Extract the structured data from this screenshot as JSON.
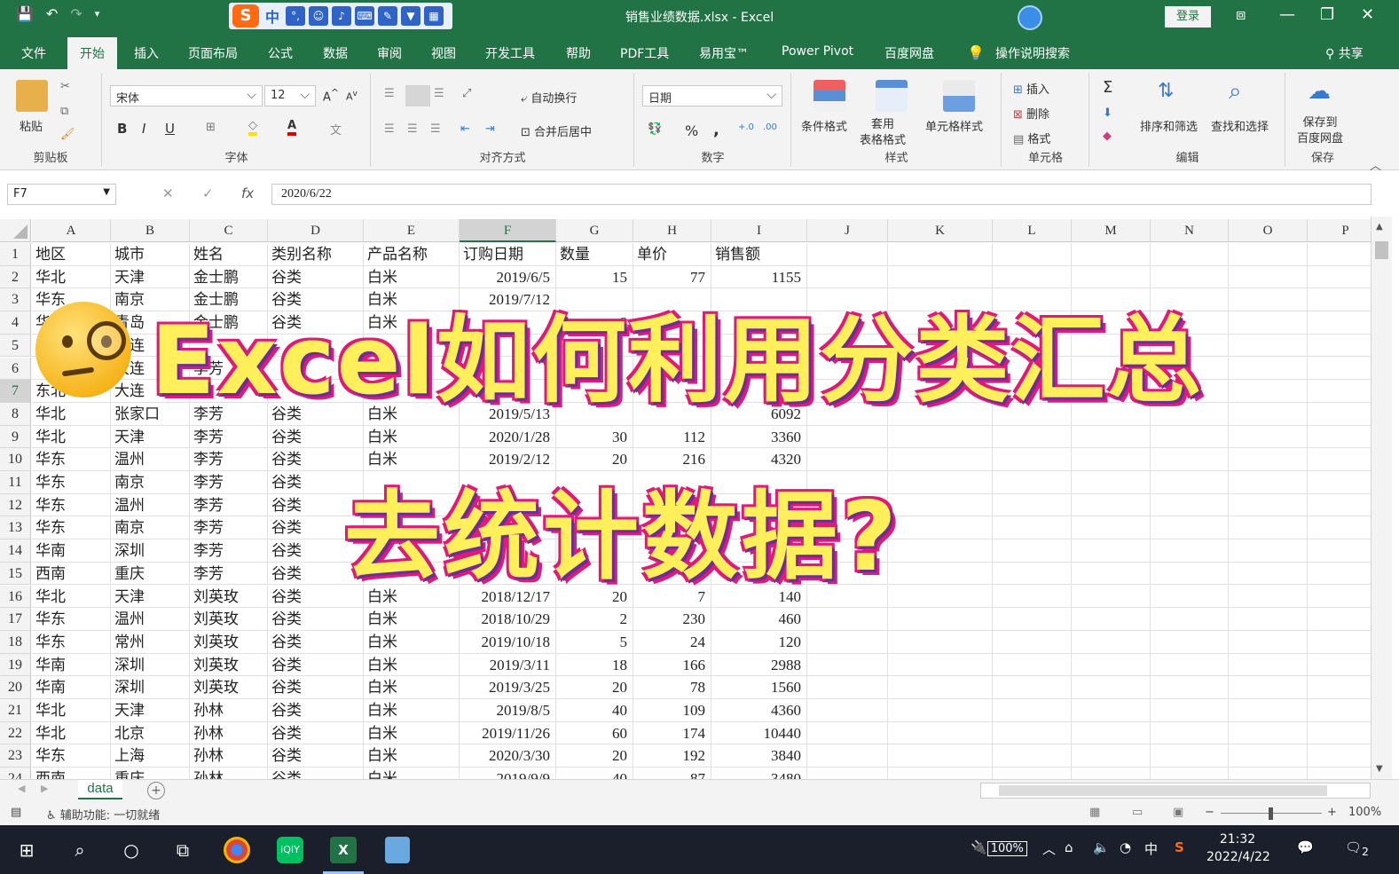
{
  "window": {
    "title": "销售业绩数据.xlsx  -  Excel",
    "login_label": "登录"
  },
  "ime": {
    "logo": "S",
    "mode": "中"
  },
  "tabs": [
    "文件",
    "开始",
    "插入",
    "页面布局",
    "公式",
    "数据",
    "审阅",
    "视图",
    "开发工具",
    "帮助",
    "PDF工具",
    "易用宝™",
    "Power Pivot",
    "百度网盘",
    "操作说明搜索"
  ],
  "active_tab": "开始",
  "share_label": "共享",
  "ribbon": {
    "clipboard": {
      "paste": "粘贴",
      "label": "剪贴板"
    },
    "font": {
      "name": "宋体",
      "size": "12",
      "label": "字体",
      "bold": "B",
      "italic": "I",
      "underline": "U"
    },
    "alignment": {
      "wrap": "自动换行",
      "merge": "合并后居中",
      "label": "对齐方式"
    },
    "number": {
      "format": "日期",
      "label": "数字",
      "percent": "%",
      "comma": ","
    },
    "styles": {
      "conditional": "条件格式",
      "table": "套用\n表格格式",
      "cell_styles": "单元格样式",
      "label": "样式"
    },
    "cells": {
      "insert": "插入",
      "delete": "删除",
      "format": "格式",
      "label": "单元格"
    },
    "editing": {
      "sort": "排序和筛选",
      "find": "查找和选择",
      "label": "编辑",
      "sum": "Σ"
    },
    "save": {
      "button": "保存到\n百度网盘",
      "label": "保存"
    }
  },
  "formula_bar": {
    "cell_ref": "F7",
    "fx": "fx",
    "value": "2020/6/22"
  },
  "columns": [
    "A",
    "B",
    "C",
    "D",
    "E",
    "F",
    "G",
    "H",
    "I",
    "J",
    "K",
    "L",
    "M",
    "N",
    "O",
    "P"
  ],
  "selected_column": "F",
  "selected_row": 7,
  "rows": [
    [
      "地区",
      "城市",
      "姓名",
      "类别名称",
      "产品名称",
      "订购日期",
      "数量",
      "单价",
      "销售额"
    ],
    [
      "华北",
      "天津",
      "金士鹏",
      "谷类",
      "白米",
      "2019/6/5",
      "15",
      "77",
      "1155"
    ],
    [
      "华东",
      "南京",
      "金士鹏",
      "谷类",
      "白米",
      "2019/7/12",
      "",
      "",
      ""
    ],
    [
      "华",
      "青岛",
      "金士鹏",
      "谷类",
      "白米",
      "",
      "8",
      "",
      ""
    ],
    [
      "",
      "大连",
      "",
      "",
      "",
      "",
      "",
      "",
      ""
    ],
    [
      "",
      "大连",
      "李芳",
      "",
      "",
      "",
      "",
      "",
      ""
    ],
    [
      "东北",
      "大连",
      "",
      "",
      "",
      "",
      "",
      "",
      ""
    ],
    [
      "华北",
      "张家口",
      "李芳",
      "谷类",
      "白米",
      "2019/5/13",
      "",
      "",
      "6092"
    ],
    [
      "华北",
      "天津",
      "李芳",
      "谷类",
      "白米",
      "2020/1/28",
      "30",
      "112",
      "3360"
    ],
    [
      "华东",
      "温州",
      "李芳",
      "谷类",
      "白米",
      "2019/2/12",
      "20",
      "216",
      "4320"
    ],
    [
      "华东",
      "南京",
      "李芳",
      "谷类",
      "",
      "",
      "",
      "",
      ""
    ],
    [
      "华东",
      "温州",
      "李芳",
      "谷类",
      "",
      "",
      "",
      "",
      ""
    ],
    [
      "华东",
      "南京",
      "李芳",
      "谷类",
      "",
      "",
      "",
      "",
      ""
    ],
    [
      "华南",
      "深圳",
      "李芳",
      "谷类",
      "",
      "",
      "",
      "",
      ""
    ],
    [
      "西南",
      "重庆",
      "李芳",
      "谷类",
      "",
      "",
      "",
      "",
      ""
    ],
    [
      "华北",
      "天津",
      "刘英玫",
      "谷类",
      "白米",
      "2018/12/17",
      "20",
      "7",
      "140"
    ],
    [
      "华东",
      "温州",
      "刘英玫",
      "谷类",
      "白米",
      "2018/10/29",
      "2",
      "230",
      "460"
    ],
    [
      "华东",
      "常州",
      "刘英玫",
      "谷类",
      "白米",
      "2019/10/18",
      "5",
      "24",
      "120"
    ],
    [
      "华南",
      "深圳",
      "刘英玫",
      "谷类",
      "白米",
      "2019/3/11",
      "18",
      "166",
      "2988"
    ],
    [
      "华南",
      "深圳",
      "刘英玫",
      "谷类",
      "白米",
      "2019/3/25",
      "20",
      "78",
      "1560"
    ],
    [
      "华北",
      "天津",
      "孙林",
      "谷类",
      "白米",
      "2019/8/5",
      "40",
      "109",
      "4360"
    ],
    [
      "华北",
      "北京",
      "孙林",
      "谷类",
      "白米",
      "2019/11/26",
      "60",
      "174",
      "10440"
    ],
    [
      "华东",
      "上海",
      "孙林",
      "谷类",
      "白米",
      "2020/3/30",
      "20",
      "192",
      "3840"
    ],
    [
      "西南",
      "重庆",
      "孙林",
      "谷类",
      "白米",
      "2019/9/9",
      "40",
      "87",
      "3480"
    ]
  ],
  "sheet": {
    "name": "data",
    "add": "+"
  },
  "status": {
    "accessibility": "辅助功能: 一切就绪",
    "zoom": "100%"
  },
  "overlay": {
    "line1": "Excel如何利用分类汇总",
    "line2": "去统计数据?"
  },
  "taskbar": {
    "battery": "100%",
    "ime": "中",
    "time": "21:32",
    "date": "2022/4/22",
    "notif": "2"
  },
  "colors": {
    "excel_green": "#217346",
    "overlay_fill": "#ffef5a",
    "overlay_outline": "#e0197a"
  }
}
